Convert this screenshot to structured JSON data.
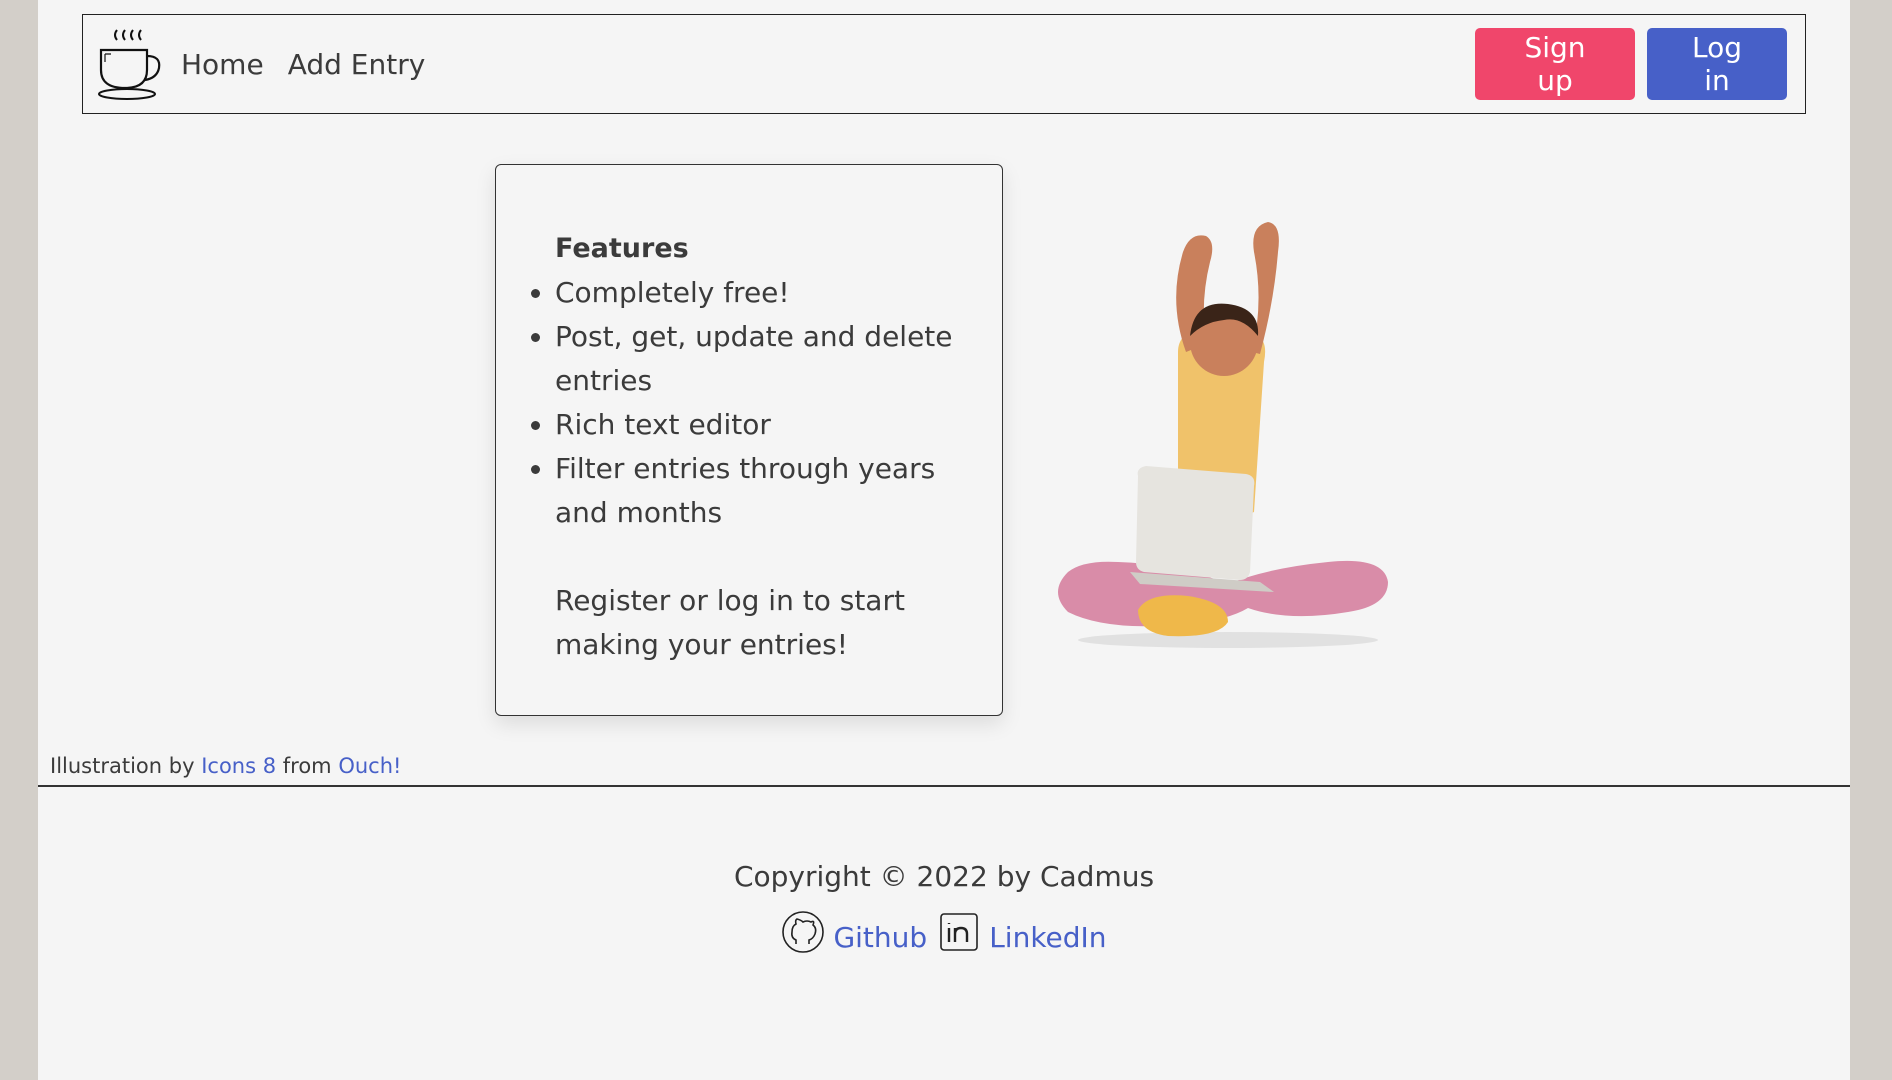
{
  "nav": {
    "logo_icon": "coffee-cup-icon",
    "links": [
      "Home",
      "Add Entry"
    ],
    "signup_label": "Sign up",
    "login_label": "Log in"
  },
  "colors": {
    "signup": "#f0466b",
    "login": "#4760c8",
    "link": "#4760c8"
  },
  "features": {
    "title": "Features",
    "items": [
      "Completely free!",
      "Post, get, update and delete entries",
      "Rich text editor",
      "Filter entries through years and months"
    ],
    "cta": "Register or log in to start making your entries!"
  },
  "credit": {
    "prefix": "Illustration by",
    "source1": "Icons 8",
    "middle": "from",
    "source2": "Ouch!"
  },
  "footer": {
    "copyright": "Copyright © 2022 by Cadmus",
    "github_label": "Github",
    "linkedin_label": "LinkedIn",
    "github_icon": "github-icon",
    "linkedin_icon": "linkedin-icon"
  }
}
